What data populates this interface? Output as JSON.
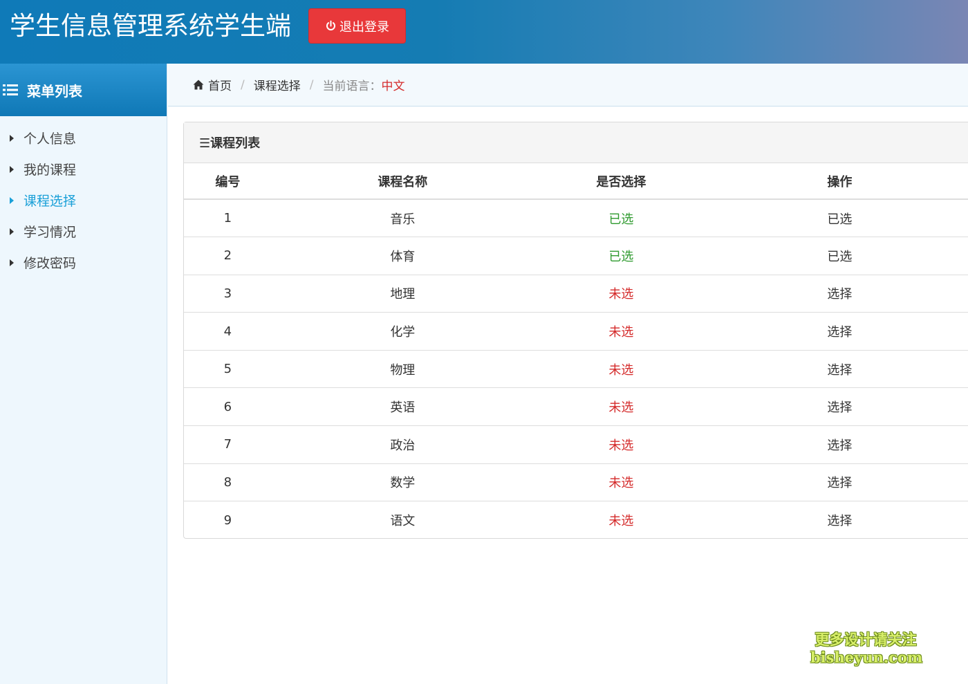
{
  "header": {
    "title": "学生信息管理系统学生端",
    "logout_label": "退出登录",
    "logout_icon": "power-icon",
    "brand_color": "#1479b6",
    "logout_color": "#e8383a"
  },
  "sidebar": {
    "heading": "菜单列表",
    "heading_icon": "list-icon",
    "items": [
      {
        "label": "个人信息",
        "active": false
      },
      {
        "label": "我的课程",
        "active": false
      },
      {
        "label": "课程选择",
        "active": true
      },
      {
        "label": "学习情况",
        "active": false
      },
      {
        "label": "修改密码",
        "active": false
      }
    ],
    "active_color": "#1aa0d8"
  },
  "breadcrumb": {
    "home_icon": "home-icon",
    "home": "首页",
    "current": "课程选择",
    "lang_label": "当前语言：",
    "lang_value": "中文"
  },
  "panel": {
    "title": "☰课程列表",
    "columns": [
      "编号",
      "课程名称",
      "是否选择",
      "操作"
    ],
    "rows": [
      {
        "id": "1",
        "name": "音乐",
        "status": "已选",
        "action": "已选"
      },
      {
        "id": "2",
        "name": "体育",
        "status": "已选",
        "action": "已选"
      },
      {
        "id": "3",
        "name": "地理",
        "status": "未选",
        "action": "选择"
      },
      {
        "id": "4",
        "name": "化学",
        "status": "未选",
        "action": "选择"
      },
      {
        "id": "5",
        "name": "物理",
        "status": "未选",
        "action": "选择"
      },
      {
        "id": "6",
        "name": "英语",
        "status": "未选",
        "action": "选择"
      },
      {
        "id": "7",
        "name": "政治",
        "status": "未选",
        "action": "选择"
      },
      {
        "id": "8",
        "name": "数学",
        "status": "未选",
        "action": "选择"
      },
      {
        "id": "9",
        "name": "语文",
        "status": "未选",
        "action": "选择"
      }
    ],
    "selected_color": "#2e9a2e",
    "unselected_color": "#d42a2a"
  },
  "watermark": {
    "line1": "更多设计请关注",
    "line2": "bisheyun.com"
  }
}
